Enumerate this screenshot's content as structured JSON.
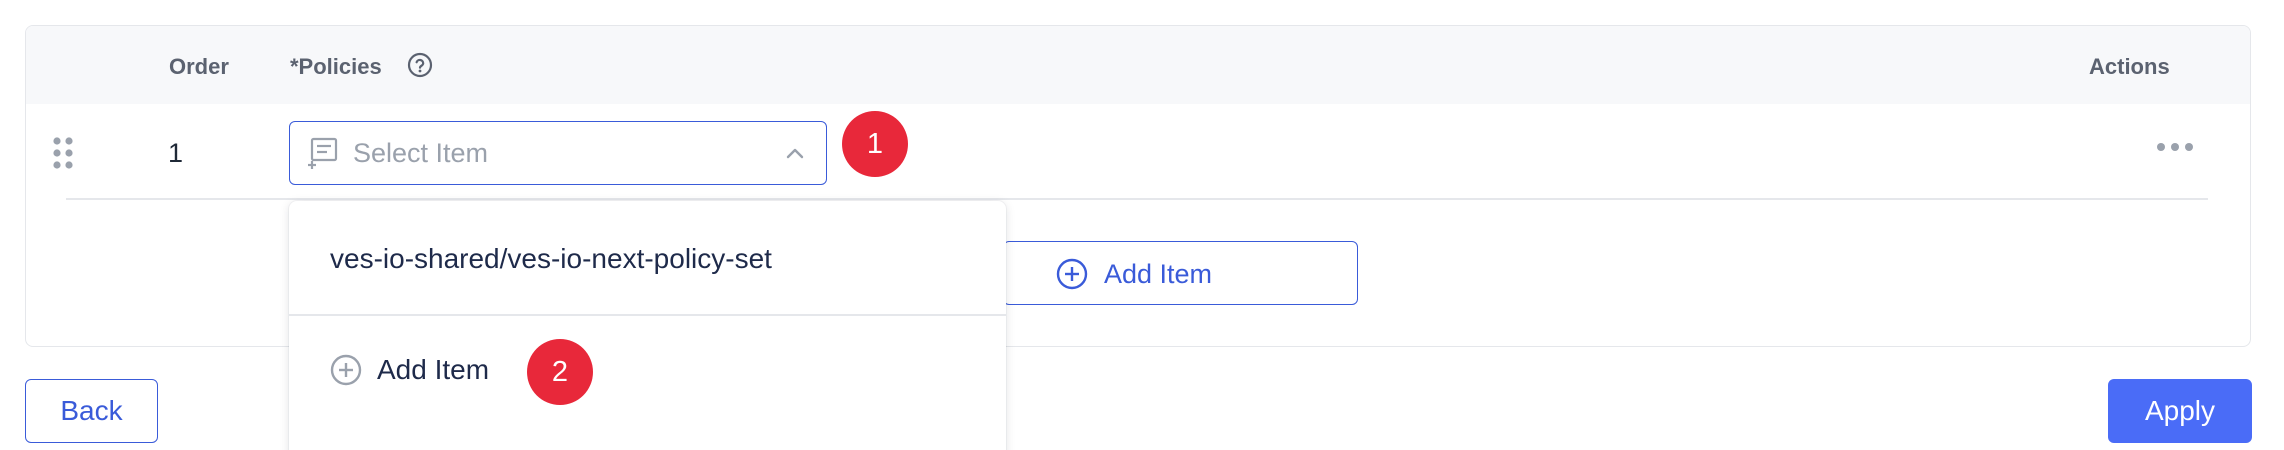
{
  "table": {
    "headers": {
      "order": "Order",
      "policies": "*Policies",
      "actions": "Actions"
    },
    "rows": [
      {
        "order": "1",
        "select_placeholder": "Select Item"
      }
    ],
    "add_item_label": "Add Item"
  },
  "dropdown": {
    "options": [
      "ves-io-shared/ves-io-next-policy-set"
    ],
    "add_item_label": "Add Item"
  },
  "annotations": [
    "1",
    "2"
  ],
  "footer": {
    "back_label": "Back",
    "apply_label": "Apply"
  },
  "icons": {
    "help": "help-circle-icon",
    "drag": "drag-handle-icon",
    "select": "list-add-icon",
    "chevron": "chevron-up-icon",
    "more": "more-horizontal-icon",
    "add": "plus-circle-icon"
  },
  "colors": {
    "primary": "#3a5bd9",
    "apply": "#4a6cf7",
    "badge": "#e8283a",
    "header_bg": "#f7f8fa"
  }
}
